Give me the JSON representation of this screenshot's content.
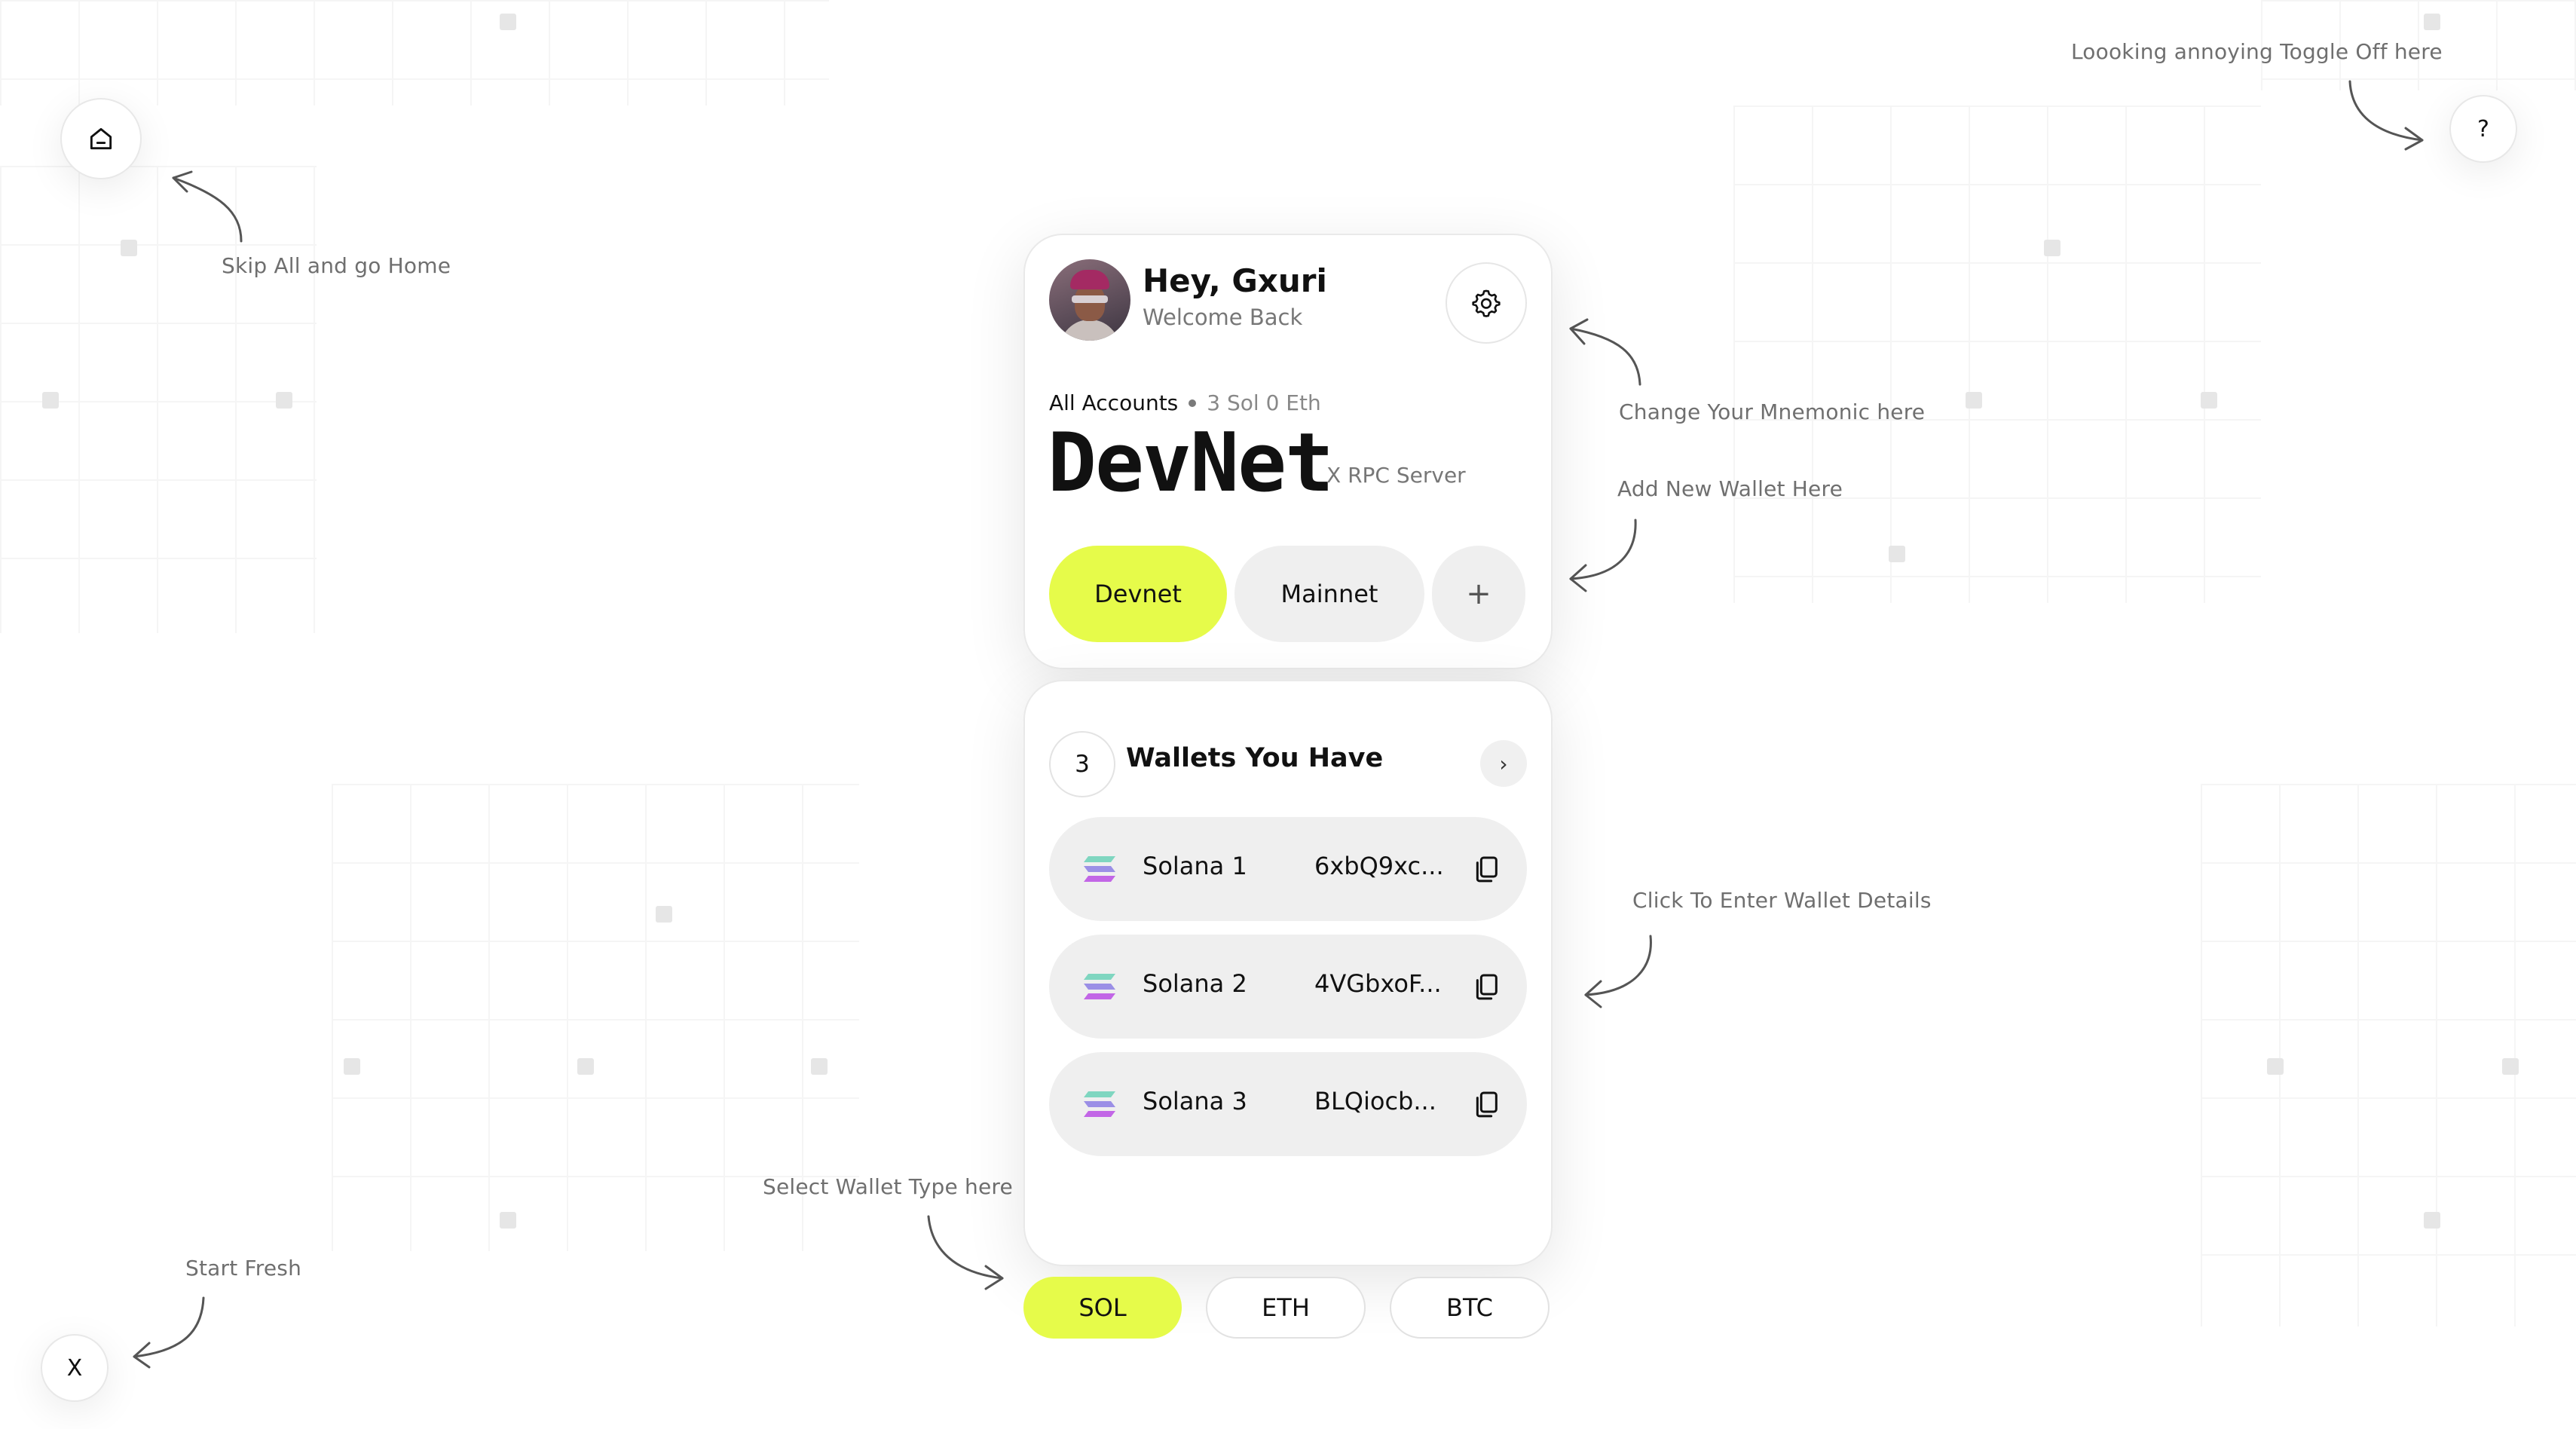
{
  "hints": {
    "home": "Skip All and go Home",
    "toggle_off": "Loooking annoying Toggle Off here",
    "mnemonic": "Change Your Mnemonic here",
    "add_wallet": "Add New Wallet Here",
    "wallet_details": "Click To Enter Wallet Details",
    "wallet_type": "Select Wallet Type here",
    "start_fresh": "Start Fresh"
  },
  "corner_buttons": {
    "help_label": "?",
    "reset_label": "X",
    "home_icon": "home-icon"
  },
  "header": {
    "greeting": "Hey, Gxuri",
    "subtitle": "Welcome Back",
    "settings_icon": "gear-icon"
  },
  "accounts": {
    "label": "All Accounts",
    "balance": "3 Sol 0 Eth",
    "network_title": "DevNet",
    "rpc_label": "X RPC Server"
  },
  "networks": {
    "items": [
      "Devnet",
      "Mainnet"
    ],
    "selected": "Devnet",
    "add_label": "+"
  },
  "wallets": {
    "count": "3",
    "title": "Wallets You Have",
    "next_label": "›",
    "items": [
      {
        "name": "Solana 1",
        "address": "6xbQ9xc..."
      },
      {
        "name": "Solana 2",
        "address": "4VGbxoF..."
      },
      {
        "name": "Solana 3",
        "address": "BLQiocb..."
      }
    ]
  },
  "chains": {
    "items": [
      "SOL",
      "ETH",
      "BTC"
    ],
    "selected": "SOL"
  },
  "colors": {
    "accent": "#e6fb4a",
    "pill_bg": "#efefef",
    "hint_text": "#6f6f6f"
  }
}
